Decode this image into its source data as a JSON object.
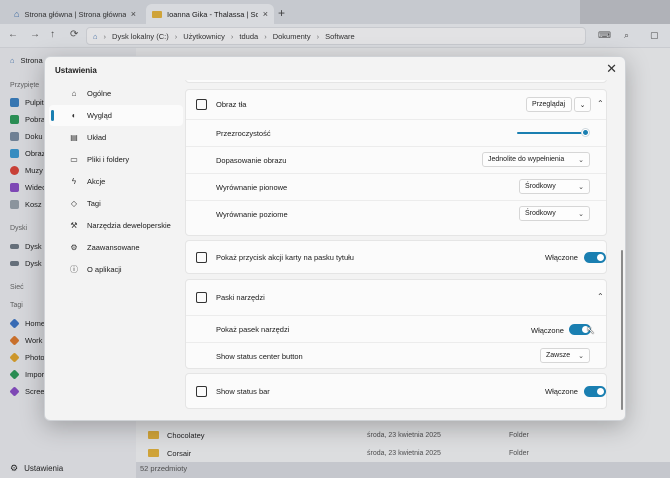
{
  "tabs": [
    {
      "label": "Strona główna | Strona główna",
      "icon": "home-icon",
      "close": "×"
    },
    {
      "label": "Ioanna Gika - Thalassa | Software",
      "icon": "folder-icon",
      "close": "×"
    }
  ],
  "new_tab": "+",
  "toolbar": {
    "path": [
      "Dysk lokalny (C:)",
      "Użytkownicy",
      "tduda",
      "Dokumenty",
      "Software"
    ]
  },
  "sidebar": {
    "home": "Strona",
    "pinned_header": "Przypięte",
    "pinned": [
      "Pulpit",
      "Pobra",
      "Doku",
      "Obraz",
      "Muzy",
      "Wideo",
      "Kosz"
    ],
    "drives_header": "Dyski",
    "drives": [
      "Dysk l",
      "Dysk l"
    ],
    "network_header": "Sieć",
    "tags_header": "Tagi",
    "tags": [
      "Home",
      "Work",
      "Photo",
      "Impor",
      "Scree"
    ],
    "settings_label": "Ustawienia"
  },
  "files": [
    {
      "name": "Chocolatey",
      "date": "środa, 23 kwietnia 2025",
      "type": "Folder"
    },
    {
      "name": "Corsair",
      "date": "środa, 23 kwietnia 2025",
      "type": "Folder"
    }
  ],
  "status": {
    "count": "52 przedmioty"
  },
  "dialog": {
    "title": "Ustawienia",
    "close": "✕",
    "nav": [
      {
        "label": "Ogólne",
        "icon": "home-icon"
      },
      {
        "label": "Wygląd",
        "icon": "palette-icon",
        "active": true
      },
      {
        "label": "Układ",
        "icon": "layout-icon"
      },
      {
        "label": "Pliki i foldery",
        "icon": "folder-icon"
      },
      {
        "label": "Akcje",
        "icon": "lightning-icon"
      },
      {
        "label": "Tagi",
        "icon": "tag-icon"
      },
      {
        "label": "Narzędzia deweloperskie",
        "icon": "code-icon"
      },
      {
        "label": "Zaawansowane",
        "icon": "gear-icon"
      },
      {
        "label": "O aplikacji",
        "icon": "info-icon"
      }
    ],
    "background": {
      "title": "Obraz tła",
      "browse": "Przeglądaj",
      "opacity_label": "Przezroczystość",
      "opacity_value": 1.0,
      "fit_label": "Dopasowanie obrazu",
      "fit_value": "Jednolite do wypełnienia",
      "valign_label": "Wyrównanie pionowe",
      "valign_value": "Środkowy",
      "halign_label": "Wyrównanie poziome",
      "halign_value": "Środkowy"
    },
    "tab_actions": {
      "label": "Pokaż przycisk akcji karty na pasku tytułu",
      "state": "Włączone"
    },
    "toolbars": {
      "title": "Paski narzędzi",
      "show_toolbar_label": "Pokaż pasek narzędzi",
      "show_toolbar_state": "Włączone",
      "status_center_label": "Show status center button",
      "status_center_value": "Zawsze"
    },
    "status_bar": {
      "label": "Show status bar",
      "state": "Włączone"
    }
  },
  "colors": {
    "accent": "#1a7fb1",
    "dialog_bg": "#f3f3f3",
    "card_bg": "#fbfbfb"
  }
}
